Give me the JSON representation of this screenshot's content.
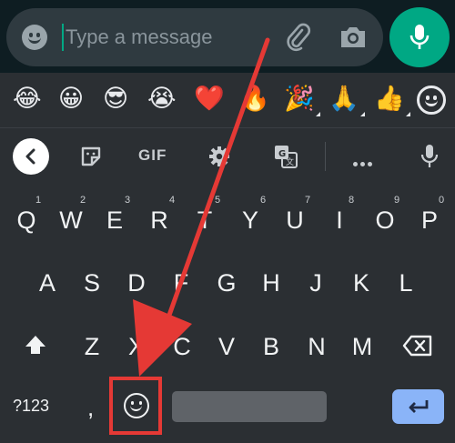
{
  "message_bar": {
    "placeholder": "Type a message",
    "icons": [
      "emoji-icon",
      "paperclip-icon",
      "camera-icon",
      "microphone-icon"
    ],
    "accent_color": "#00a884"
  },
  "emoji_suggestions": {
    "items": [
      {
        "glyph": "😂",
        "name": "tears-of-joy"
      },
      {
        "glyph": "😀",
        "name": "grinning-face"
      },
      {
        "glyph": "😎",
        "name": "sunglasses-face"
      },
      {
        "glyph": "😭",
        "name": "loudly-crying-face"
      },
      {
        "glyph": "❤️",
        "name": "red-heart"
      },
      {
        "glyph": "🔥",
        "name": "fire"
      },
      {
        "glyph": "🎉",
        "name": "party-popper"
      },
      {
        "glyph": "🙏",
        "name": "folded-hands"
      },
      {
        "glyph": "👍",
        "name": "thumbs-up"
      }
    ]
  },
  "toolbar": {
    "gif_label": "GIF",
    "icons": [
      "back-icon",
      "sticker-icon",
      "gear-icon",
      "translate-icon",
      "more-icon",
      "microphone-icon"
    ]
  },
  "keyboard": {
    "row1": [
      {
        "key": "Q",
        "hint": "1"
      },
      {
        "key": "W",
        "hint": "2"
      },
      {
        "key": "E",
        "hint": "3"
      },
      {
        "key": "R",
        "hint": "4"
      },
      {
        "key": "T",
        "hint": "5"
      },
      {
        "key": "Y",
        "hint": "6"
      },
      {
        "key": "U",
        "hint": "7"
      },
      {
        "key": "I",
        "hint": "8"
      },
      {
        "key": "O",
        "hint": "9"
      },
      {
        "key": "P",
        "hint": "0"
      }
    ],
    "row2": [
      "A",
      "S",
      "D",
      "F",
      "G",
      "H",
      "J",
      "K",
      "L"
    ],
    "row3": [
      "Z",
      "X",
      "C",
      "V",
      "B",
      "N",
      "M"
    ],
    "symbols_label": "?123",
    "comma_label": ",",
    "highlight_color": "#e53935",
    "enter_color": "#8ab4f8"
  }
}
